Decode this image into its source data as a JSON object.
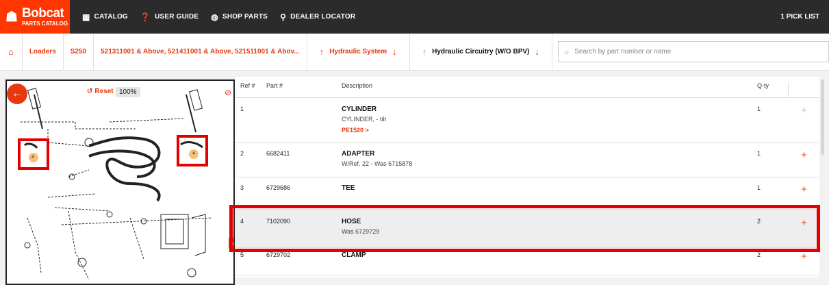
{
  "brand": {
    "name": "Bobcat",
    "sub": "PARTS CATALOG",
    "accent": "#ff3600"
  },
  "nav": {
    "items": [
      {
        "icon": "grid-icon",
        "glyph": "▦",
        "label": "CATALOG"
      },
      {
        "icon": "help-icon",
        "glyph": "❓",
        "label": "USER GUIDE"
      },
      {
        "icon": "globe-icon",
        "glyph": "◍",
        "label": "SHOP PARTS"
      },
      {
        "icon": "pin-icon",
        "glyph": "⚲",
        "label": "DEALER LOCATOR"
      }
    ],
    "picklist": "1  PICK LIST"
  },
  "breadcrumb": {
    "home_icon": "home-icon",
    "items": [
      "Loaders",
      "S250",
      "521311001 & Above, 521411001 & Above, 521511001 & Abov..."
    ],
    "system": "Hydraulic System",
    "current": "Hydraulic Circuitry (W/O BPV)"
  },
  "search": {
    "placeholder": "Search by part number or name"
  },
  "diagram": {
    "reset_label": "Reset",
    "zoom": "100%",
    "callout_number": "4"
  },
  "table": {
    "headers": {
      "ref": "Ref #",
      "part": "Part #",
      "desc": "Description",
      "qty": "Q-ty"
    },
    "rows": [
      {
        "ref": "1",
        "part": "",
        "title": "CYLINDER",
        "sub": "CYLINDER, - tilt",
        "link": "PE1520 >",
        "qty": "1"
      },
      {
        "ref": "2",
        "part": "6682411",
        "title": "ADAPTER",
        "sub": "W/Ref. 22 - Was 6715878",
        "link": "",
        "qty": "1"
      },
      {
        "ref": "3",
        "part": "6729686",
        "title": "TEE",
        "sub": "",
        "link": "",
        "qty": "1"
      },
      {
        "ref": "4",
        "part": "7102090",
        "title": "HOSE",
        "sub": "Was 6729729",
        "link": "",
        "qty": "2"
      },
      {
        "ref": "5",
        "part": "6729702",
        "title": "CLAMP",
        "sub": "",
        "link": "",
        "qty": "2"
      }
    ]
  }
}
